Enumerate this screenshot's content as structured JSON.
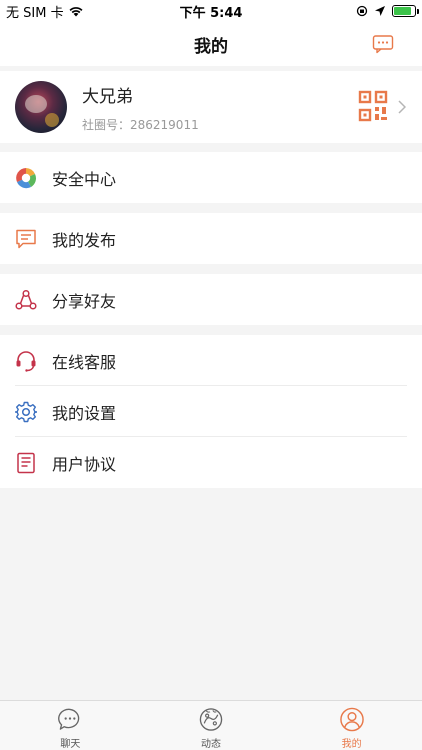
{
  "status_bar": {
    "carrier": "无 SIM 卡",
    "time": "下午 5:44",
    "battery_level": 0.85
  },
  "nav": {
    "title": "我的",
    "action_icon": "message-more-icon"
  },
  "profile": {
    "name": "大兄弟",
    "id_label": "社圈号：286219011",
    "qr_icon": "qr-code-icon"
  },
  "menu": {
    "security": "安全中心",
    "posts": "我的发布",
    "share": "分享好友",
    "service": "在线客服",
    "settings": "我的设置",
    "agreement": "用户协议"
  },
  "tabs": [
    {
      "label": "聊天",
      "icon": "chat-icon",
      "active": false
    },
    {
      "label": "动态",
      "icon": "moments-icon",
      "active": false
    },
    {
      "label": "我的",
      "icon": "profile-icon",
      "active": true
    }
  ],
  "colors": {
    "accent": "#e8794a",
    "icon_red": "#c4334a",
    "icon_blue": "#3a6fc0"
  }
}
